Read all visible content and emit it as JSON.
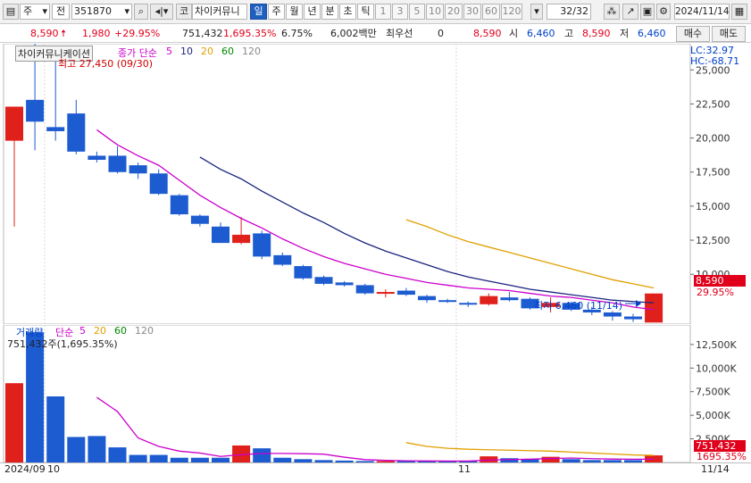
{
  "toolbar": {
    "market_type": "주",
    "period_label": "전",
    "code": "351870",
    "name_prefix": "코",
    "stock_name": "차이커뮤니",
    "periods": [
      "일",
      "주",
      "월",
      "년",
      "분",
      "초",
      "틱"
    ],
    "active_period": "일",
    "nums": [
      "1",
      "3",
      "5",
      "10",
      "20",
      "30",
      "60",
      "120"
    ],
    "page_count": "32/32",
    "date": "2024/11/14"
  },
  "quote": {
    "price": "8,590",
    "change": "1,980",
    "change_pct": "+29.95%",
    "volume": "751,432",
    "volume_pct": "1,695.35%",
    "turnover": "6.75%",
    "amount": "6,002백만",
    "priority_label": "최우선",
    "priority_value": "0",
    "ask": "8,590",
    "open_label": "시",
    "open": "6,460",
    "high_label": "고",
    "high": "8,590",
    "low_label": "저",
    "low": "6,460",
    "buy_label": "매수",
    "sell_label": "매도"
  },
  "price_panel": {
    "title": "차이커뮤니케이션",
    "indicator_label": "종가 단순",
    "ma_labels": [
      "5",
      "10",
      "20",
      "60",
      "120"
    ],
    "ma_colors": [
      "#cc00cc",
      "#1a237e",
      "#e0a000",
      "#008800",
      "#888888"
    ],
    "lc_label": "LC:32.97",
    "hc_label": "HC:-68.71",
    "high_annotation": "최고 27,450 (09/30)",
    "low_annotation": "최저 6,460 (11/14)",
    "price_tag": "8,590",
    "pct_tag": "29.95%"
  },
  "volume_panel": {
    "title": "거래량",
    "indicator_label": "단순",
    "ma_labels": [
      "5",
      "20",
      "60",
      "120"
    ],
    "ma_colors": [
      "#cc00cc",
      "#e0a000",
      "#008800",
      "#888888"
    ],
    "first_volume_label": "751,432주(1,695.35%)",
    "vol_tag": "751,432",
    "pct_tag": "1695.35%"
  },
  "xaxis": {
    "labels": [
      "2024/09",
      "10",
      "11",
      "11/14"
    ]
  },
  "chart_data": [
    {
      "type": "candlestick",
      "title": "차이커뮤니케이션",
      "ylim": [
        7000,
        26000
      ],
      "yticks": [
        10000,
        12500,
        15000,
        17500,
        20000,
        22500,
        25000
      ],
      "ytick_labels": [
        "10,000",
        "12,500",
        "15,000",
        "17,500",
        "20,000",
        "22,500",
        "25,000"
      ],
      "candles": [
        {
          "o": 19800,
          "c": 22300,
          "h": 22300,
          "l": 13500
        },
        {
          "o": 22800,
          "c": 21200,
          "h": 27450,
          "l": 19100
        },
        {
          "o": 20800,
          "c": 20500,
          "h": 25700,
          "l": 19800
        },
        {
          "o": 21800,
          "c": 19000,
          "h": 22800,
          "l": 18800
        },
        {
          "o": 18700,
          "c": 18400,
          "h": 19000,
          "l": 18200
        },
        {
          "o": 18700,
          "c": 17500,
          "h": 19400,
          "l": 17400
        },
        {
          "o": 18000,
          "c": 17400,
          "h": 18200,
          "l": 17000
        },
        {
          "o": 17400,
          "c": 15900,
          "h": 17700,
          "l": 15800
        },
        {
          "o": 15800,
          "c": 14400,
          "h": 15900,
          "l": 14300
        },
        {
          "o": 14300,
          "c": 13700,
          "h": 14400,
          "l": 13500
        },
        {
          "o": 13500,
          "c": 12300,
          "h": 13800,
          "l": 12300
        },
        {
          "o": 12300,
          "c": 12900,
          "h": 14200,
          "l": 12200
        },
        {
          "o": 13000,
          "c": 11300,
          "h": 13200,
          "l": 11100
        },
        {
          "o": 11400,
          "c": 10700,
          "h": 11600,
          "l": 10600
        },
        {
          "o": 10600,
          "c": 9700,
          "h": 10700,
          "l": 9600
        },
        {
          "o": 9800,
          "c": 9300,
          "h": 9900,
          "l": 9200
        },
        {
          "o": 9400,
          "c": 9200,
          "h": 9500,
          "l": 9100
        },
        {
          "o": 9200,
          "c": 8600,
          "h": 9300,
          "l": 8500
        },
        {
          "o": 8600,
          "c": 8700,
          "h": 8900,
          "l": 8300
        },
        {
          "o": 8800,
          "c": 8500,
          "h": 9000,
          "l": 8400
        },
        {
          "o": 8400,
          "c": 8100,
          "h": 8500,
          "l": 7900
        },
        {
          "o": 8100,
          "c": 8000,
          "h": 8200,
          "l": 7900
        },
        {
          "o": 7900,
          "c": 7800,
          "h": 8000,
          "l": 7600
        },
        {
          "o": 7800,
          "c": 8400,
          "h": 8600,
          "l": 7700
        },
        {
          "o": 8300,
          "c": 8100,
          "h": 8700,
          "l": 8000
        },
        {
          "o": 8200,
          "c": 7500,
          "h": 8300,
          "l": 7400
        },
        {
          "o": 7600,
          "c": 7900,
          "h": 8300,
          "l": 7200
        },
        {
          "o": 7900,
          "c": 7400,
          "h": 8000,
          "l": 7300
        },
        {
          "o": 7400,
          "c": 7200,
          "h": 7600,
          "l": 7000
        },
        {
          "o": 7200,
          "c": 6900,
          "h": 7300,
          "l": 6600
        },
        {
          "o": 6900,
          "c": 6700,
          "h": 7100,
          "l": 6500
        },
        {
          "o": 6460,
          "c": 8590,
          "h": 8590,
          "l": 6460
        }
      ],
      "ma5": [
        null,
        null,
        null,
        null,
        20600,
        19500,
        18700,
        18000,
        16900,
        15800,
        14900,
        14100,
        13400,
        12600,
        11900,
        11300,
        10800,
        10400,
        10000,
        9700,
        9400,
        9200,
        9000,
        8900,
        8800,
        8600,
        8400,
        8300,
        8100,
        7900,
        7600,
        7400
      ],
      "ma10": [
        null,
        null,
        null,
        null,
        null,
        null,
        null,
        null,
        null,
        18600,
        17700,
        17000,
        16100,
        15300,
        14500,
        13800,
        13000,
        12300,
        11700,
        11200,
        10700,
        10200,
        9800,
        9500,
        9200,
        8900,
        8700,
        8500,
        8300,
        8100,
        8000,
        7900
      ],
      "ma20": [
        null,
        null,
        null,
        null,
        null,
        null,
        null,
        null,
        null,
        null,
        null,
        null,
        null,
        null,
        null,
        null,
        null,
        null,
        null,
        14000,
        13500,
        12900,
        12400,
        12000,
        11600,
        11200,
        10800,
        10400,
        10000,
        9600,
        9300,
        9000
      ]
    },
    {
      "type": "bar",
      "title": "거래량",
      "ylim": [
        0,
        14000
      ],
      "yticks": [
        2500,
        5000,
        7500,
        10000,
        12500
      ],
      "ytick_labels": [
        "2,500K",
        "5,000K",
        "7,500K",
        "10,000K",
        "12,500K"
      ],
      "values": [
        8400,
        13800,
        7000,
        2700,
        2800,
        1600,
        800,
        800,
        500,
        500,
        500,
        1800,
        1500,
        500,
        350,
        250,
        200,
        150,
        150,
        150,
        150,
        150,
        150,
        650,
        450,
        350,
        600,
        350,
        250,
        250,
        250,
        751
      ],
      "ma5": [
        null,
        null,
        null,
        null,
        6900,
        5400,
        2600,
        1700,
        1200,
        1000,
        640,
        820,
        960,
        960,
        930,
        880,
        560,
        300,
        220,
        180,
        160,
        150,
        150,
        250,
        310,
        350,
        420,
        470,
        400,
        360,
        340,
        350
      ],
      "ma20": [
        null,
        null,
        null,
        null,
        null,
        null,
        null,
        null,
        null,
        null,
        null,
        null,
        null,
        null,
        null,
        null,
        null,
        null,
        null,
        2100,
        1700,
        1500,
        1400,
        1350,
        1300,
        1250,
        1200,
        1100,
        1000,
        900,
        800,
        750
      ]
    }
  ]
}
